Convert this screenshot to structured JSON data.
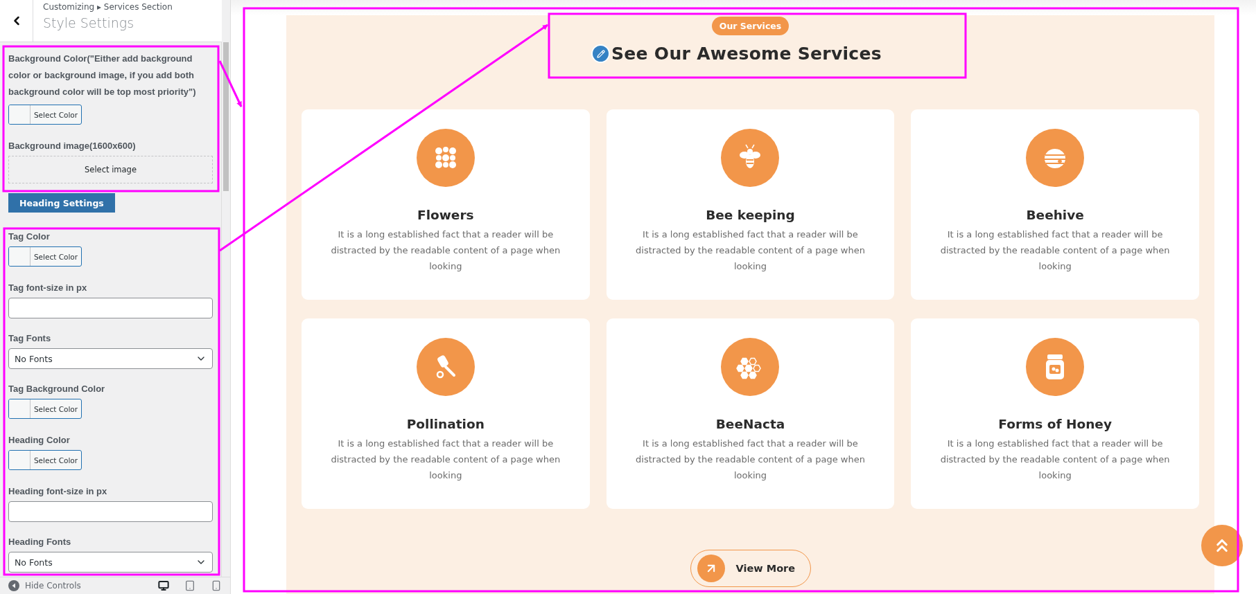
{
  "sidebar": {
    "breadcrumb": "Customizing ▸ Services Section",
    "title": "Style Settings",
    "controls": [
      {
        "kind": "color",
        "label": "Background Color(\"Either add background color or background image, if you add both background color will be top most priority\")",
        "button": "Select Color"
      },
      {
        "kind": "image",
        "label": "Background image(1600x600)",
        "button": "Select image"
      },
      {
        "kind": "section",
        "button": "Heading Settings"
      },
      {
        "kind": "color",
        "label": "Tag Color",
        "button": "Select Color"
      },
      {
        "kind": "text",
        "label": "Tag font-size in px"
      },
      {
        "kind": "select",
        "label": "Tag Fonts",
        "value": "No Fonts"
      },
      {
        "kind": "color",
        "label": "Tag Background Color",
        "button": "Select Color"
      },
      {
        "kind": "color",
        "label": "Heading Color",
        "button": "Select Color"
      },
      {
        "kind": "text",
        "label": "Heading font-size in px"
      },
      {
        "kind": "select",
        "label": "Heading Fonts",
        "value": "No Fonts"
      }
    ],
    "footer": {
      "toggle": "Hide Controls",
      "devices": [
        {
          "kind": "desktop",
          "selected": true
        },
        {
          "kind": "tablet",
          "selected": false
        },
        {
          "kind": "mobile",
          "selected": false
        }
      ]
    }
  },
  "preview": {
    "tag": "Our Services",
    "heading": "See Our Awesome Services",
    "services": [
      {
        "kind": "flowers",
        "title": "Flowers",
        "text": "It is a long established fact that a reader will be distracted by the readable content of a page when looking"
      },
      {
        "kind": "bee",
        "title": "Bee keeping",
        "text": "It is a long established fact that a reader will be distracted by the readable content of a page when looking"
      },
      {
        "kind": "beehive",
        "title": "Beehive",
        "text": "It is a long established fact that a reader will be distracted by the readable content of a page when looking"
      },
      {
        "kind": "dipper",
        "title": "Pollination",
        "text": "It is a long established fact that a reader will be distracted by the readable content of a page when looking"
      },
      {
        "kind": "honeycomb",
        "title": "BeeNacta",
        "text": "It is a long established fact that a reader will be distracted by the readable content of a page when looking"
      },
      {
        "kind": "jar",
        "title": "Forms of Honey",
        "text": "It is a long established fact that a reader will be distracted by the readable content of a page when looking"
      }
    ],
    "more_button": "View More"
  }
}
